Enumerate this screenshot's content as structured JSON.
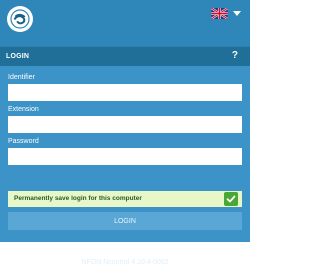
{
  "header": {
    "logo_icon": "nfon-logo-icon",
    "language_flag": "uk-flag-icon",
    "language_caret": "chevron-down-icon"
  },
  "login": {
    "title": "LOGIN",
    "help_label": "?",
    "fields": [
      {
        "label": "Identifier",
        "value": ""
      },
      {
        "label": "Extension",
        "value": ""
      },
      {
        "label": "Password",
        "value": ""
      }
    ],
    "save_label": "Permanently save login for this computer",
    "save_checked": true,
    "button_label": "LOGIN"
  },
  "footer": {
    "version": "NFON Ncontrol 4.10.4-0002"
  },
  "colors": {
    "topbar": "#2f86b8",
    "panel": "#3b93c7",
    "header": "#1f6f99",
    "button": "#5aa7d6",
    "check_green": "#49a833",
    "save_row": "#e7f7c8"
  }
}
